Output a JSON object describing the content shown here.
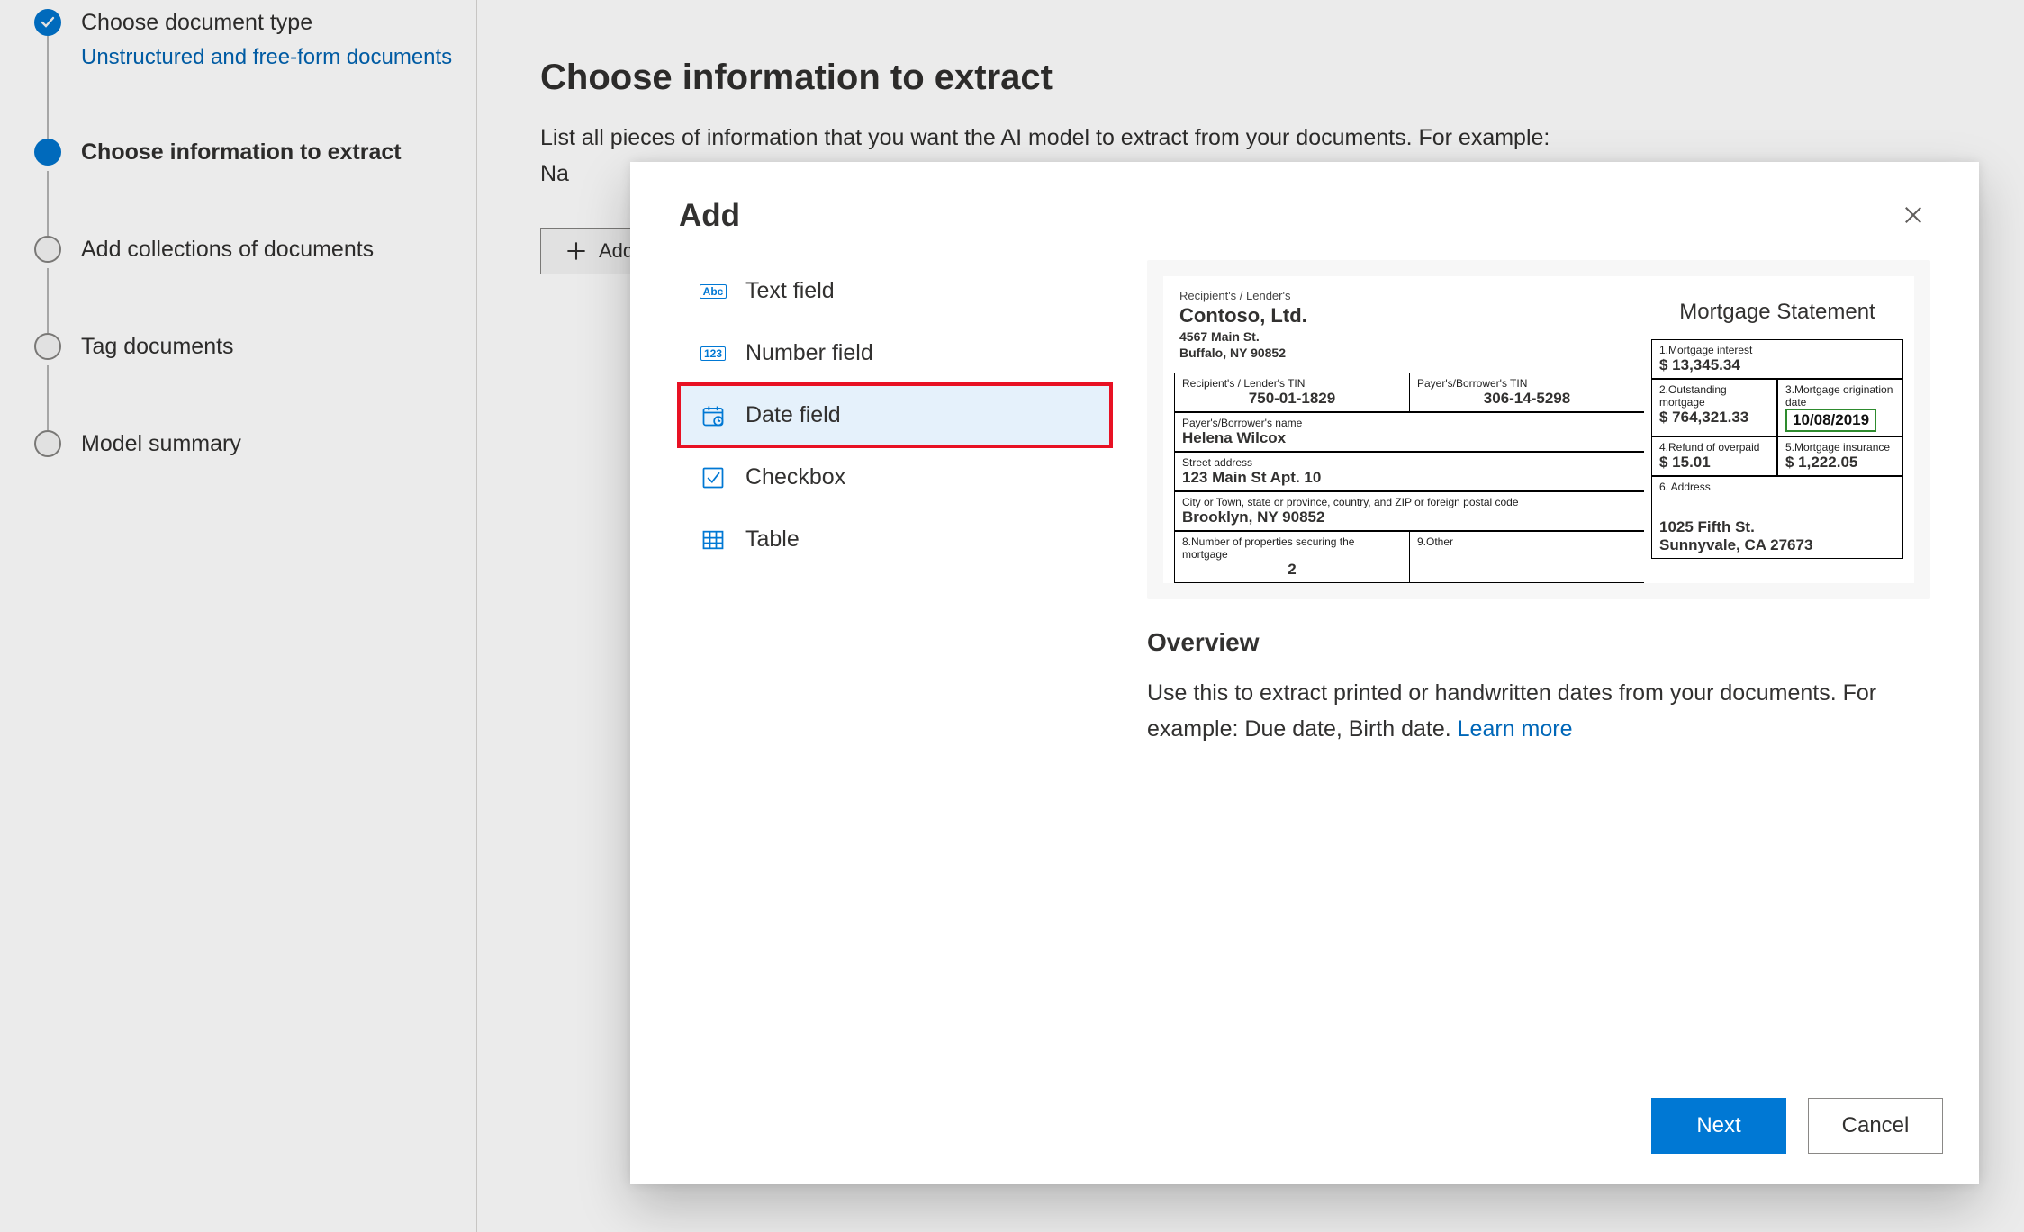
{
  "stepper": {
    "s1_title": "Choose document type",
    "s1_sub": "Unstructured and free-form documents",
    "s2_title": "Choose information to extract",
    "s3_title": "Add collections of documents",
    "s4_title": "Tag documents",
    "s5_title": "Model summary"
  },
  "main": {
    "heading": "Choose information to extract",
    "desc": "List all pieces of information that you want the AI model to extract from your documents. For example: Na",
    "add_label": "Add"
  },
  "modal": {
    "title": "Add",
    "types": {
      "text": "Text field",
      "number": "Number field",
      "date": "Date field",
      "checkbox": "Checkbox",
      "table": "Table"
    },
    "overview_title": "Overview",
    "overview_text": "Use this to extract printed or handwritten dates from your documents. For example: Due date, Birth date. ",
    "learn_more": "Learn more",
    "next": "Next",
    "cancel": "Cancel"
  },
  "preview_doc": {
    "recipient_label": "Recipient's / Lender's",
    "company": "Contoso, Ltd.",
    "addr1": "4567 Main St.",
    "addr2": "Buffalo, NY 90852",
    "heading": "Mortgage Statement",
    "tin_left_lbl": "Recipient's / Lender's TIN",
    "tin_left": "750-01-1829",
    "tin_right_lbl": "Payer's/Borrower's TIN",
    "tin_right": "306-14-5298",
    "borrower_lbl": "Payer's/Borrower's name",
    "borrower": "Helena Wilcox",
    "street_lbl": "Street address",
    "street": "123 Main St Apt. 10",
    "city_lbl": "City or Town, state or province, country, and ZIP or foreign postal code",
    "city": "Brooklyn, NY 90852",
    "props_lbl": "8.Number of properties securing the mortgage",
    "props": "2",
    "other_lbl": "9.Other",
    "r1_lbl": "1.Mortgage interest",
    "r1_val": "$  13,345.34",
    "r2a_lbl": "2.Outstanding mortgage",
    "r2a_val": "$  764,321.33",
    "r2b_lbl": "3.Mortgage origination date",
    "r2b_val": "10/08/2019",
    "r3a_lbl": "4.Refund of overpaid",
    "r3a_val": "$  15.01",
    "r3b_lbl": "5.Mortgage insurance",
    "r3b_val": "$  1,222.05",
    "r4_lbl": "6. Address",
    "r4_v1": "1025 Fifth St.",
    "r4_v2": "Sunnyvale, CA 27673"
  }
}
